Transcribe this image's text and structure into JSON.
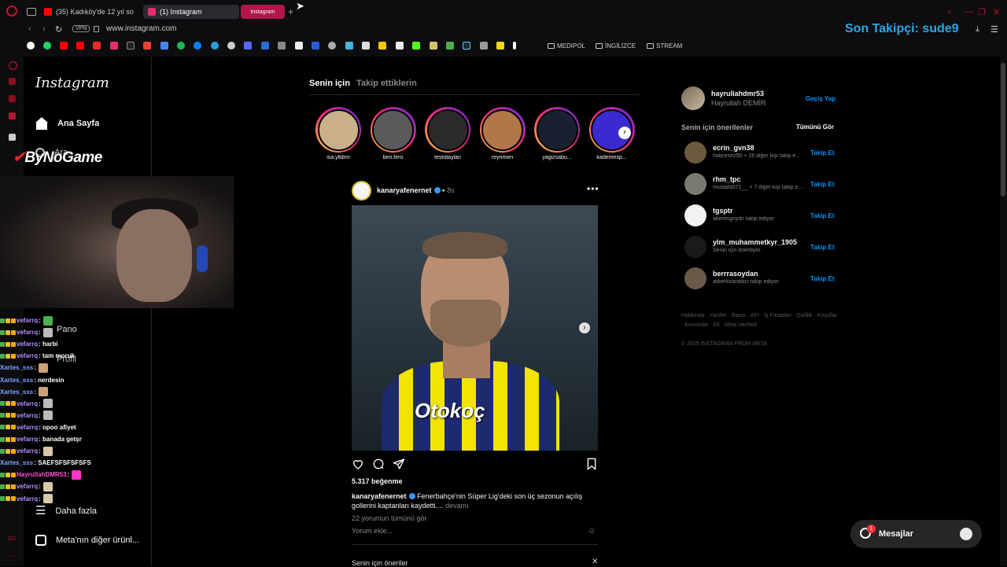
{
  "browser": {
    "tabs": [
      {
        "label": "(35) Kadıköy'de 12 yıl son",
        "color": "#ff0000"
      },
      {
        "label": "(1) Instagram",
        "color": "#e1306c"
      }
    ],
    "pink_tab": "Instagram",
    "url": "www.instagram.com",
    "vpn": "VPN",
    "bookmark_folders": [
      "MEDIPOL",
      "İNGİLİZCE",
      "STREAM"
    ]
  },
  "overlay": {
    "follower_text": "Son Takipçi: sude9",
    "brand_mark": "✔",
    "brand": "ByNoGame"
  },
  "nav": {
    "logo": "Instagram",
    "items": {
      "home": "Ana Sayfa",
      "search": "Ara",
      "dashboard": "Pano",
      "profile": "Profil",
      "more": "Daha fazla",
      "meta": "Meta'nın diğer ürünl..."
    }
  },
  "chat": [
    {
      "user": "vefarrq",
      "msg": ":",
      "color": "#b28dff",
      "emote": "#4caf50"
    },
    {
      "user": "vefarrq",
      "msg": ":",
      "color": "#b28dff",
      "emote": "#bbbbbb"
    },
    {
      "user": "vefarrq",
      "msg": ": harbi",
      "color": "#b28dff",
      "emote": ""
    },
    {
      "user": "vefarrq",
      "msg": ": tam moruk",
      "color": "#b28dff",
      "emote": ""
    },
    {
      "user": "Xartes_sss",
      "msg": ":",
      "color": "#7aa2ff",
      "emote": "#c9a27a"
    },
    {
      "user": "Xartes_sss",
      "msg": ": nerdesin",
      "color": "#7aa2ff",
      "emote": ""
    },
    {
      "user": "Xartes_sss",
      "msg": ":",
      "color": "#7aa2ff",
      "emote": "#c9a27a"
    },
    {
      "user": "vefarrq",
      "msg": ":",
      "color": "#b28dff",
      "emote": "#bbbbbb"
    },
    {
      "user": "vefarrq",
      "msg": ":",
      "color": "#b28dff",
      "emote": "#bbbbbb"
    },
    {
      "user": "vefarrq",
      "msg": ": opoo afiyet",
      "color": "#b28dff",
      "emote": ""
    },
    {
      "user": "vefarrq",
      "msg": ": banada getşr",
      "color": "#b28dff",
      "emote": ""
    },
    {
      "user": "vefarrq",
      "msg": ":",
      "color": "#b28dff",
      "emote": "#d8c8a8"
    },
    {
      "user": "Xartes_sss",
      "msg": ": SAEFSFSFSFSFS",
      "color": "#7aa2ff",
      "emote": ""
    },
    {
      "user": "HayrullahDMR53",
      "msg": ":",
      "color": "#ff4fd8",
      "emote": "#ff33cc"
    },
    {
      "user": "vefarrq",
      "msg": ":",
      "color": "#b28dff",
      "emote": "#d8c8a8"
    },
    {
      "user": "vefarrq",
      "msg": ":",
      "color": "#b28dff",
      "emote": "#d8c8a8"
    }
  ],
  "feed": {
    "tabs": [
      "Senin için",
      "Takip ettiklerin"
    ],
    "stories": [
      {
        "name": "isa.ylldrm",
        "color": "#c9b08a"
      },
      {
        "name": "ben.fero",
        "color": "#5a5a5a"
      },
      {
        "name": "testotaylan",
        "color": "#2a2a2a"
      },
      {
        "name": "reynmen",
        "color": "#b07848"
      },
      {
        "name": "yagizsabu...",
        "color": "#1a2030"
      },
      {
        "name": "kademesp...",
        "color": "#3a2ad0"
      }
    ],
    "post": {
      "user": "kanaryafenernet",
      "time": "8s",
      "sponsor": "Otokoç",
      "likes": "5.317 beğenme",
      "caption_user": "kanaryafenernet",
      "caption": "Fenerbahçe'nin Süper Lig'deki son üç sezonun açılış gollerini kaptanları kaydetti....",
      "caption_more": "devamı",
      "comments": "22 yorumun tümünü gör",
      "add_comment": "Yorum ekle..."
    },
    "suggestions_footer": "Senin için öneriler"
  },
  "right": {
    "me": {
      "user": "hayrullahdmr53",
      "name": "Hayrullah DEMİR",
      "switch": "Geçiş Yap"
    },
    "suggestions_title": "Senin için önerilenler",
    "see_all": "Tümünü Gör",
    "follow_label": "Takip Et",
    "suggestions": [
      {
        "user": "ecrin_gvn38",
        "sub": "haticesez50 + 16 diğer kişi takip ediyor",
        "color": "#6b5a40"
      },
      {
        "user": "rhm_tpc",
        "sub": "mustafa571__ + 7 diğer kişi takip ediyor",
        "color": "#7a7a70"
      },
      {
        "user": "tgsptr",
        "sub": "akerimgnydn takip ediyor",
        "color": "#f2f2f2"
      },
      {
        "user": "ylm_muhammetkyr_1905",
        "sub": "Senin için öneriliyor",
        "color": "#1a1a1a"
      },
      {
        "user": "berrrasoydan",
        "sub": "aliberksandikci takip ediyor",
        "color": "#6a5a4a"
      }
    ],
    "footer_links": "Hakkında · Yardım · Basın · API · İş Fırsatları · Gizlilik · Koşullar · Konumlar · Dil · Meta Verified",
    "copyright": "© 2025 INSTAGRAM FROM META"
  },
  "messages": {
    "label": "Mesajlar",
    "badge": "1"
  }
}
